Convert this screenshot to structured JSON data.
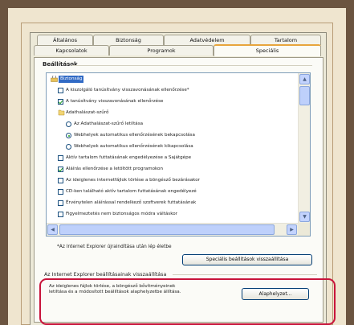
{
  "tabs": {
    "row1": [
      "Általános",
      "Biztonság",
      "Adatvédelem",
      "Tartalom"
    ],
    "row2": [
      "Kapcsolatok",
      "Programok",
      "Speciális"
    ]
  },
  "settings_group": {
    "title": "Beállítások"
  },
  "tree": [
    {
      "kind": "folder",
      "label": "Biztonság",
      "selected": true
    },
    {
      "kind": "checkbox",
      "checked": false,
      "label": "A kiszolgáló tanúsítvány visszavonásának ellenőrzése*"
    },
    {
      "kind": "checkbox",
      "checked": true,
      "label": "A tanúsítvány visszavonásának ellenőrzése"
    },
    {
      "kind": "category",
      "label": "Adathalászat-szűrő"
    },
    {
      "kind": "radio",
      "checked": false,
      "label": "Az Adathalászat-szűrő letiltása"
    },
    {
      "kind": "radio",
      "checked": true,
      "label": "Webhelyek automatikus ellenőrzésének bekapcsolása"
    },
    {
      "kind": "radio",
      "checked": false,
      "label": "Webhelyek automatikus ellenőrzésének kikapcsolása"
    },
    {
      "kind": "checkbox",
      "checked": false,
      "label": "Aktív tartalom futtatásának engedélyezése a Sajátgépe"
    },
    {
      "kind": "checkbox",
      "checked": true,
      "label": "Aláírás ellenőrzése a letöltött programokon"
    },
    {
      "kind": "checkbox",
      "checked": false,
      "label": "Az ideiglenes internetfájlok törlése a böngésző bezárásakor"
    },
    {
      "kind": "checkbox",
      "checked": false,
      "label": "CD-ken található aktív tartalom futtatásának engedélyezé"
    },
    {
      "kind": "checkbox",
      "checked": false,
      "label": "Érvénytelen aláírással rendelkező szoftverek futtatásának"
    },
    {
      "kind": "checkbox",
      "checked": false,
      "label": "Figyelmeztetés nem biztonságos módra váltáskor"
    }
  ],
  "note": "*Az Internet Explorer újraindítása után lép életbe",
  "restore_advanced_button": "Speciális beállítások visszaállítása",
  "reset_section": {
    "title": "Az Internet Explorer beállításainak visszaállítása",
    "description": "Az ideiglenes fájlok törlése, a böngésző bővítményeinek letiltása és a módosított beállítások alaphelyzetbe állítása.",
    "button": "Alaphelyzet..."
  },
  "colors": {
    "highlight": "#c8143b",
    "selection": "#316ac5",
    "active_tab_accent": "#e7a53c"
  }
}
